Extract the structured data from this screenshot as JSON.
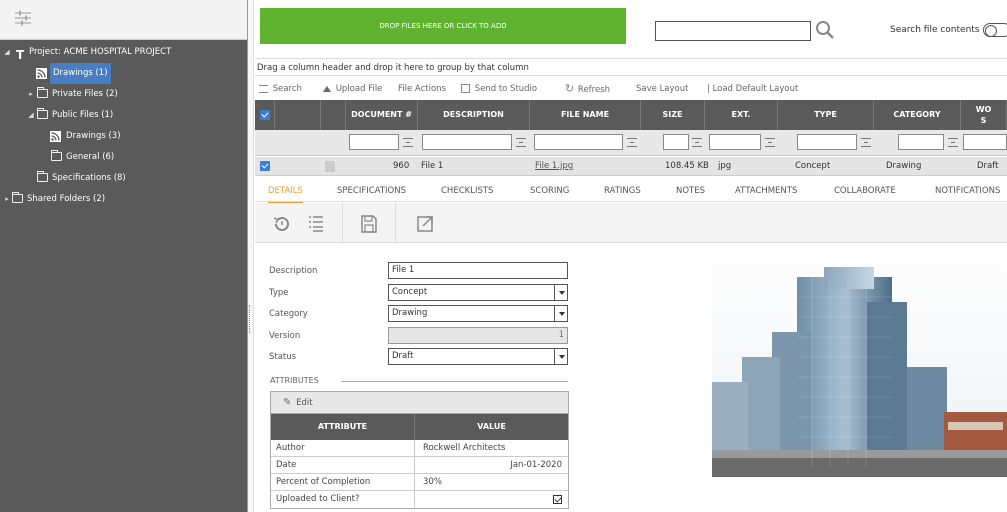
{
  "sidebar": {
    "items": [
      {
        "label": "Project: ACME HOSPITAL PROJECT",
        "arrow": "◢"
      },
      {
        "label": "Drawings (1)"
      },
      {
        "label": "Private Files (2)",
        "arrow": "▸"
      },
      {
        "label": "Public Files (1)",
        "arrow": "◢"
      },
      {
        "label": "Drawings (3)"
      },
      {
        "label": "General (6)"
      },
      {
        "label": "Specifications (8)"
      },
      {
        "label": "Shared Folders (2)",
        "arrow": "▸"
      }
    ]
  },
  "upload": {
    "drop_label": "DROP FILES HERE OR CLICK TO ADD",
    "search_value": "",
    "search_contents_label": "Search file contents"
  },
  "grid": {
    "group_hint": "Drag a column header and drop it here to group by that column",
    "toolbar": {
      "search": "Search",
      "upload": "Upload File",
      "file_actions": "File Actions",
      "send_studio": "Send to Studio",
      "refresh": "Refresh",
      "save_layout": "Save Layout",
      "load_default": "| Load Default Layout"
    },
    "columns": {
      "document": "DOCUMENT #",
      "description": "DESCRIPTION",
      "file_name": "FILE NAME",
      "size": "SIZE",
      "ext": "EXT.",
      "type": "TYPE",
      "category": "CATEGORY",
      "wo_line1": "WO",
      "wo_line2": "S"
    },
    "row": {
      "document": "960",
      "description": "File 1",
      "file_name": "File 1.jpg",
      "size": "108.45 KB",
      "ext": "jpg",
      "type": "Concept",
      "category": "Drawing",
      "status": "Draft"
    }
  },
  "tabs": [
    "DETAILS",
    "SPECIFICATIONS",
    "CHECKLISTS",
    "SCORING",
    "RATINGS",
    "NOTES",
    "ATTACHMENTS",
    "COLLABORATE",
    "NOTIFICATIONS"
  ],
  "form": {
    "description_label": "Description",
    "description_value": "File 1",
    "type_label": "Type",
    "type_value": "Concept",
    "category_label": "Category",
    "category_value": "Drawing",
    "version_label": "Version",
    "version_value": "1",
    "status_label": "Status",
    "status_value": "Draft"
  },
  "attributes": {
    "title": "ATTRIBUTES",
    "edit_label": "Edit",
    "col_attribute": "ATTRIBUTE",
    "col_value": "VALUE",
    "rows": [
      {
        "name": "Author",
        "value": "Rockwell Architects"
      },
      {
        "name": "Date",
        "value": "Jan-01-2020"
      },
      {
        "name": "Percent of Completion",
        "value": "30%"
      },
      {
        "name": "Uploaded to Client?",
        "value": ""
      }
    ],
    "uploaded_checked": true
  },
  "colors": {
    "drop_zone": "#5fb32e",
    "selected": "#4a7ec2",
    "active_tab": "#f0a030",
    "header": "#5a5a5a"
  }
}
